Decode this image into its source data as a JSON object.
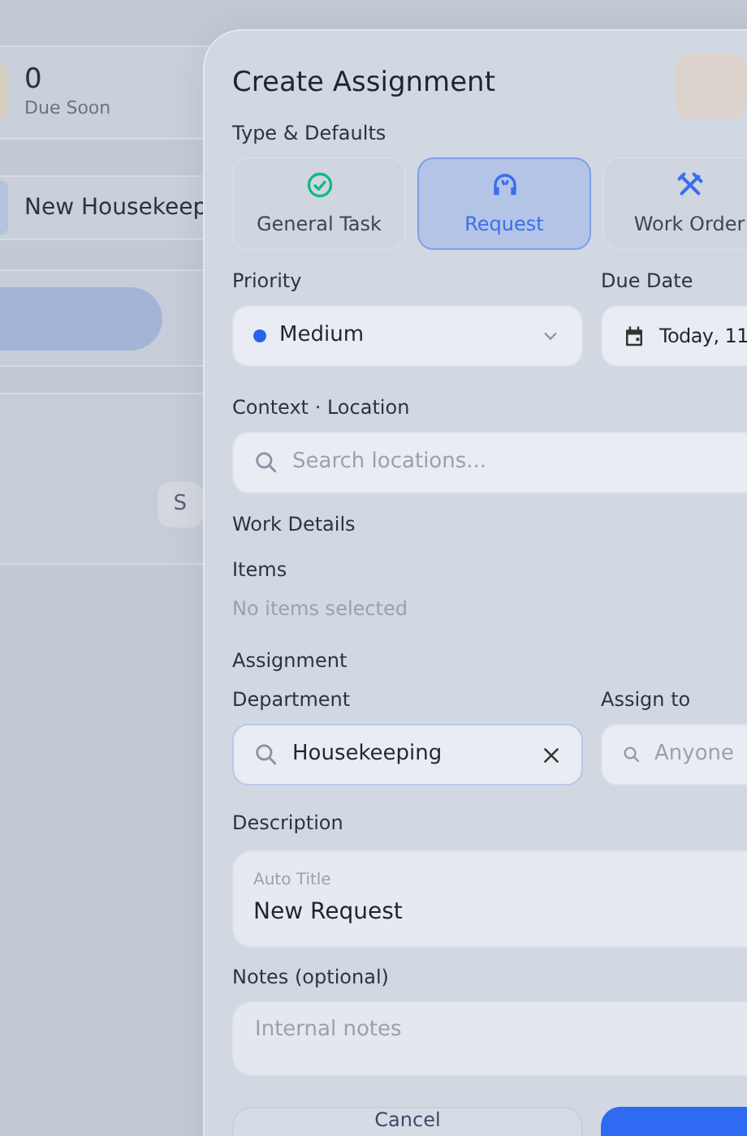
{
  "background": {
    "stat": {
      "value": "0",
      "label": "Due Soon"
    },
    "row": {
      "title": "New Housekeep"
    },
    "chip": {
      "label": "S"
    }
  },
  "modal": {
    "title": "Create Assignment",
    "type_label": "Type & Defaults",
    "types": [
      {
        "kind": "task",
        "label": "General Task",
        "selected": false
      },
      {
        "kind": "request",
        "label": "Request",
        "selected": true
      },
      {
        "kind": "workorder",
        "label": "Work Order",
        "selected": false
      }
    ],
    "priority": {
      "label": "Priority",
      "value": "Medium",
      "color": "#2563eb"
    },
    "due_date": {
      "label": "Due Date",
      "value": "Today, 11"
    },
    "location": {
      "label": "Context · Location",
      "placeholder": "Search locations..."
    },
    "work_details": {
      "title": "Work Details",
      "items_label": "Items",
      "items_empty": "No items selected"
    },
    "assignment": {
      "title": "Assignment",
      "department": {
        "label": "Department",
        "value": "Housekeeping"
      },
      "assign_to": {
        "label": "Assign to",
        "placeholder": "Anyone"
      }
    },
    "description": {
      "label": "Description",
      "field_label": "Auto Title",
      "value": "New Request"
    },
    "notes": {
      "label": "Notes (optional)",
      "placeholder": "Internal notes"
    },
    "buttons": {
      "cancel": "Cancel"
    }
  }
}
